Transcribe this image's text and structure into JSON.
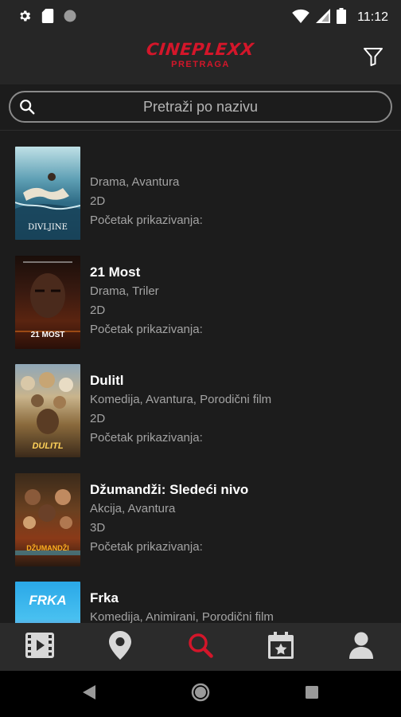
{
  "status_bar": {
    "time": "11:12",
    "icons": [
      "gear-icon",
      "sd-card-icon",
      "circle-icon",
      "wifi-icon",
      "signal-icon",
      "battery-icon"
    ]
  },
  "header": {
    "logo_text": "CINEPLEXX",
    "subtitle": "PRETRAGA",
    "filter_icon": "filter-icon",
    "brand_color": "#d3162a"
  },
  "search": {
    "placeholder": "Pretraži po nazivu",
    "icon": "search-icon"
  },
  "movies": [
    {
      "title": "",
      "genre": "Drama, Avantura",
      "format": "2D",
      "start": "Početak prikazivanja:",
      "poster_text": "DIVLJINE"
    },
    {
      "title": "21 Most",
      "genre": "Drama, Triler",
      "format": "2D",
      "start": "Početak prikazivanja:",
      "poster_text": "21 MOST"
    },
    {
      "title": "Dulitl",
      "genre": "Komedija, Avantura, Porodični film",
      "format": "2D",
      "start": "Početak prikazivanja:",
      "poster_text": "DULITL"
    },
    {
      "title": "Džumandži: Sledeći nivo",
      "genre": "Akcija, Avantura",
      "format": "3D",
      "start": "Početak prikazivanja:",
      "poster_text": "DŽUMANDŽI"
    },
    {
      "title": "Frka",
      "genre": "Komedija, Animirani, Porodični film",
      "format": "",
      "start": "",
      "poster_text": "FRKA"
    }
  ],
  "bottom_nav": {
    "items": [
      "film-icon",
      "location-pin-icon",
      "search-icon",
      "calendar-star-icon",
      "user-icon"
    ],
    "active_index": 2,
    "active_color": "#d3162a"
  },
  "system_nav": [
    "back-icon",
    "home-icon",
    "recents-icon"
  ]
}
